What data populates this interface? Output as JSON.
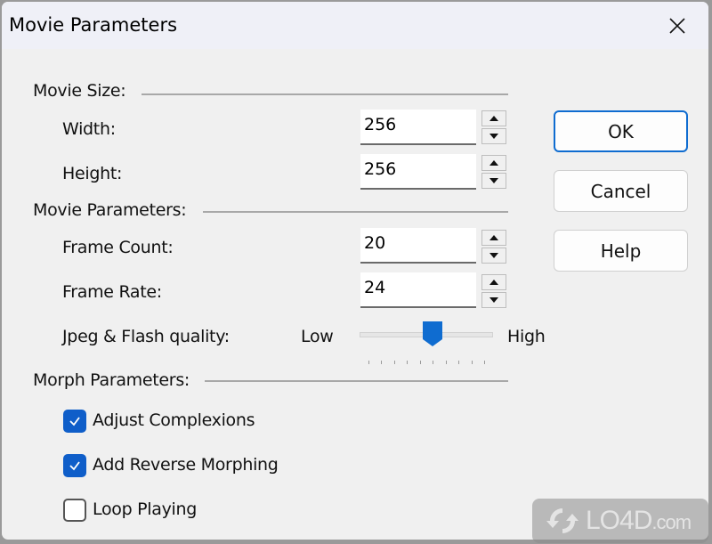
{
  "window": {
    "title": "Movie Parameters",
    "close_icon": "close-icon"
  },
  "groups": {
    "movie_size": "Movie Size:",
    "movie_parameters": "Movie Parameters:",
    "morph_parameters": "Morph Parameters:"
  },
  "fields": {
    "width": {
      "label": "Width:",
      "value": "256"
    },
    "height": {
      "label": "Height:",
      "value": "256"
    },
    "frame_count": {
      "label": "Frame Count:",
      "value": "20"
    },
    "frame_rate": {
      "label": "Frame Rate:",
      "value": "24"
    }
  },
  "quality": {
    "label": "Jpeg & Flash quality:",
    "low_label": "Low",
    "high_label": "High",
    "min": 0,
    "max": 9,
    "value": 5,
    "tick_count": 10
  },
  "checkboxes": [
    {
      "label": "Adjust Complexions",
      "checked": true
    },
    {
      "label": "Add Reverse Morphing",
      "checked": true
    },
    {
      "label": "Loop Playing",
      "checked": false
    }
  ],
  "buttons": {
    "ok": "OK",
    "cancel": "Cancel",
    "help": "Help"
  },
  "colors": {
    "accent": "#0f6cd0",
    "checkbox_checked": "#0f5ec9"
  },
  "watermark": {
    "text": "LO4D",
    "suffix": ".com"
  }
}
